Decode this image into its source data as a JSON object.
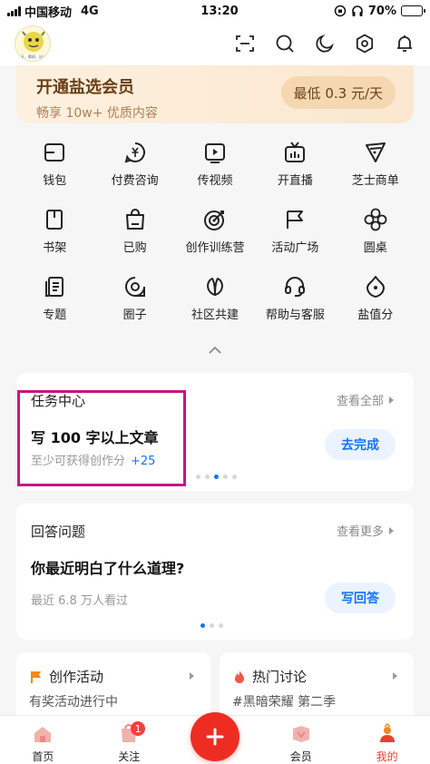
{
  "status_bar": {
    "carrier": "中国移动",
    "network": "4G",
    "time": "13:20",
    "battery": "70%",
    "battery_level": 0.7
  },
  "header": {
    "avatar_text": "每天，都很，出！",
    "icons": [
      "scan-icon",
      "search-icon",
      "night-mode-icon",
      "settings-icon",
      "notification-bell-icon"
    ]
  },
  "vip": {
    "title": "开通盐选会员",
    "subtitle": "畅享 10w+ 优质内容",
    "price_button": "最低 0.3 元/天"
  },
  "grid": [
    {
      "label": "钱包",
      "icon": "wallet-icon"
    },
    {
      "label": "付费咨询",
      "icon": "paid-consult-icon"
    },
    {
      "label": "传视频",
      "icon": "upload-video-icon"
    },
    {
      "label": "开直播",
      "icon": "live-tv-icon"
    },
    {
      "label": "芝士商单",
      "icon": "cheese-order-icon"
    },
    {
      "label": "书架",
      "icon": "bookshelf-icon"
    },
    {
      "label": "已购",
      "icon": "purchased-bag-icon"
    },
    {
      "label": "创作训练营",
      "icon": "target-icon"
    },
    {
      "label": "活动广场",
      "icon": "flag-icon"
    },
    {
      "label": "圆桌",
      "icon": "roundtable-flower-icon"
    },
    {
      "label": "专题",
      "icon": "topic-doc-icon"
    },
    {
      "label": "圈子",
      "icon": "circle-icon"
    },
    {
      "label": "社区共建",
      "icon": "leaf-icon"
    },
    {
      "label": "帮助与客服",
      "icon": "headset-icon"
    },
    {
      "label": "盐值分",
      "icon": "salt-score-icon"
    }
  ],
  "task_center": {
    "title": "任务中心",
    "more": "查看全部",
    "task": "写 100 字以上文章",
    "reward_text": "至少可获得创作分",
    "reward_value": "+25",
    "button": "去完成"
  },
  "answer": {
    "title": "回答问题",
    "more": "查看更多",
    "question": "你最近明白了什么道理?",
    "meta": "最近 6.8 万人看过",
    "button": "写回答"
  },
  "creation_activity": {
    "title": "创作活动",
    "subtitle": "有奖活动进行中"
  },
  "hot_discussion": {
    "title": "热门讨论",
    "subtitle": "#黑暗荣耀 第二季"
  },
  "tabbar": {
    "home": "首页",
    "follow": "关注",
    "follow_badge": "1",
    "vip": "会员",
    "mine": "我的"
  },
  "colors": {
    "accent": "#1772f6",
    "fab": "#ee2d22",
    "highlight": "#c71585",
    "vip_text": "#6b3f16"
  }
}
